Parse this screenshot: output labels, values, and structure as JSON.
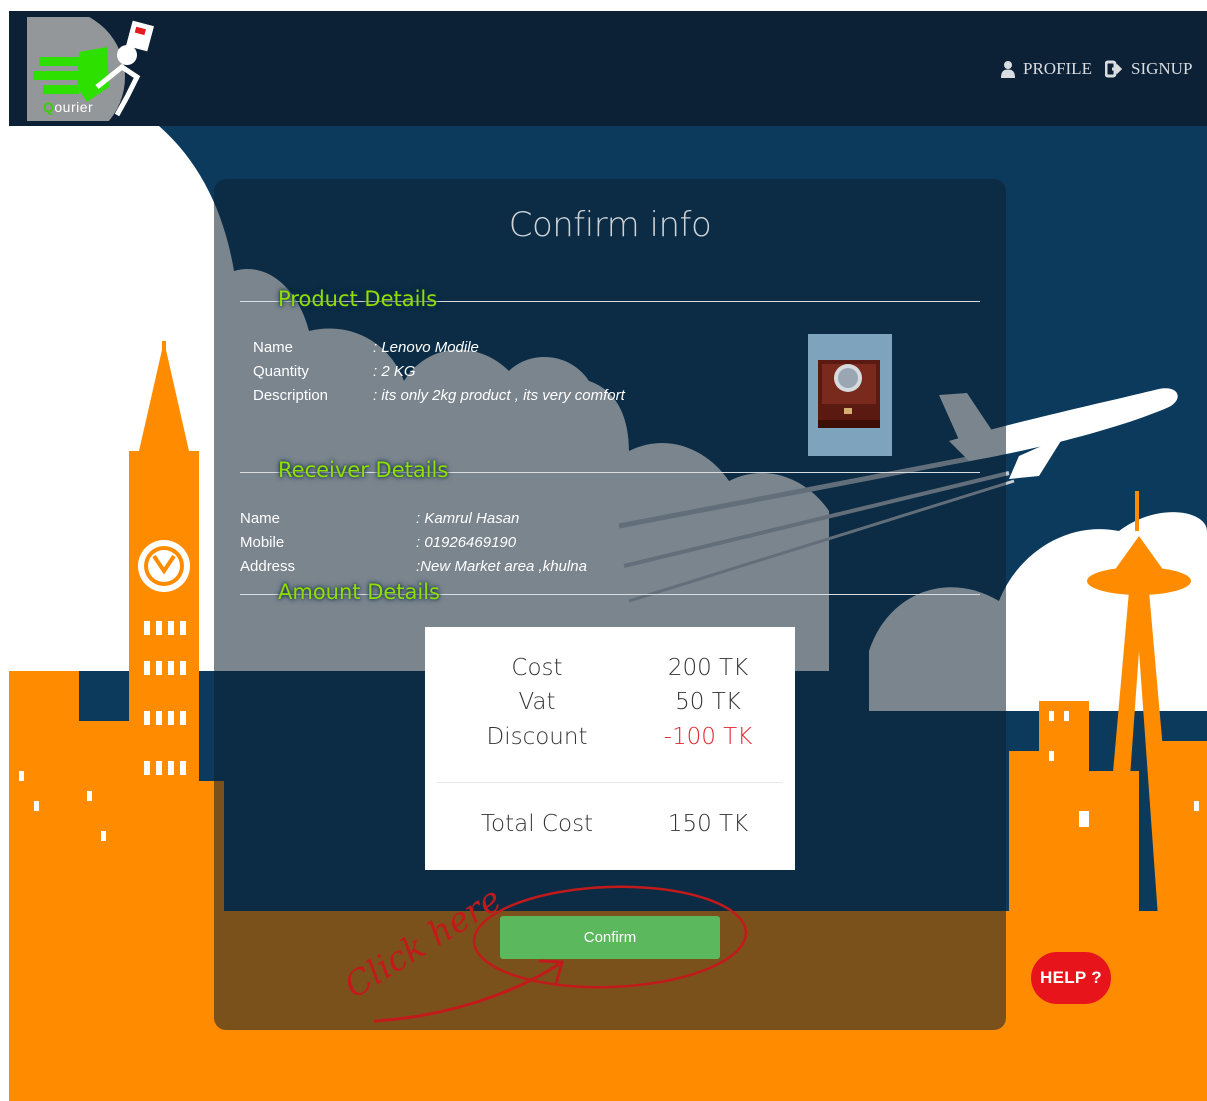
{
  "header": {
    "logo_text_q": "Q",
    "logo_text_rest": "ourier",
    "nav": [
      {
        "label": "PROFILE",
        "icon": "user-icon"
      },
      {
        "label": "SIGNUP",
        "icon": "signup-icon"
      }
    ]
  },
  "card": {
    "title": "Confirm info",
    "product": {
      "legend": "Product Details",
      "rows": [
        {
          "key": "Name",
          "value": ": Lenovo Modile"
        },
        {
          "key": "Quantity",
          "value": ": 2 KG"
        },
        {
          "key": "Description",
          "value": ": its only 2kg product , its very comfort"
        }
      ]
    },
    "receiver": {
      "legend": "Receiver Details",
      "rows": [
        {
          "key": "Name",
          "value": ": Kamrul Hasan"
        },
        {
          "key": "Mobile",
          "value": ": 01926469190"
        },
        {
          "key": "Address",
          "value": ":New Market area ,khulna"
        }
      ]
    },
    "amount": {
      "legend": "Amount Details",
      "rows": [
        {
          "label": "Cost",
          "value": "200 TK"
        },
        {
          "label": "Vat",
          "value": "50 TK"
        },
        {
          "label": "Discount",
          "value": "-100 TK"
        }
      ],
      "total_label": "Total Cost",
      "total_value": "150 TK"
    },
    "confirm_label": "Confirm",
    "annotation": "Click here"
  },
  "help_label": "HELP ?",
  "colors": {
    "navy": "#0c2136",
    "sky": "#0b3a5c",
    "orange": "#ff8c00",
    "brown": "#7a4a14",
    "confirm_green": "#5cb85c",
    "help_red": "#e8141c",
    "legend_green": "#8fe000",
    "discount_red": "#e3262e"
  }
}
